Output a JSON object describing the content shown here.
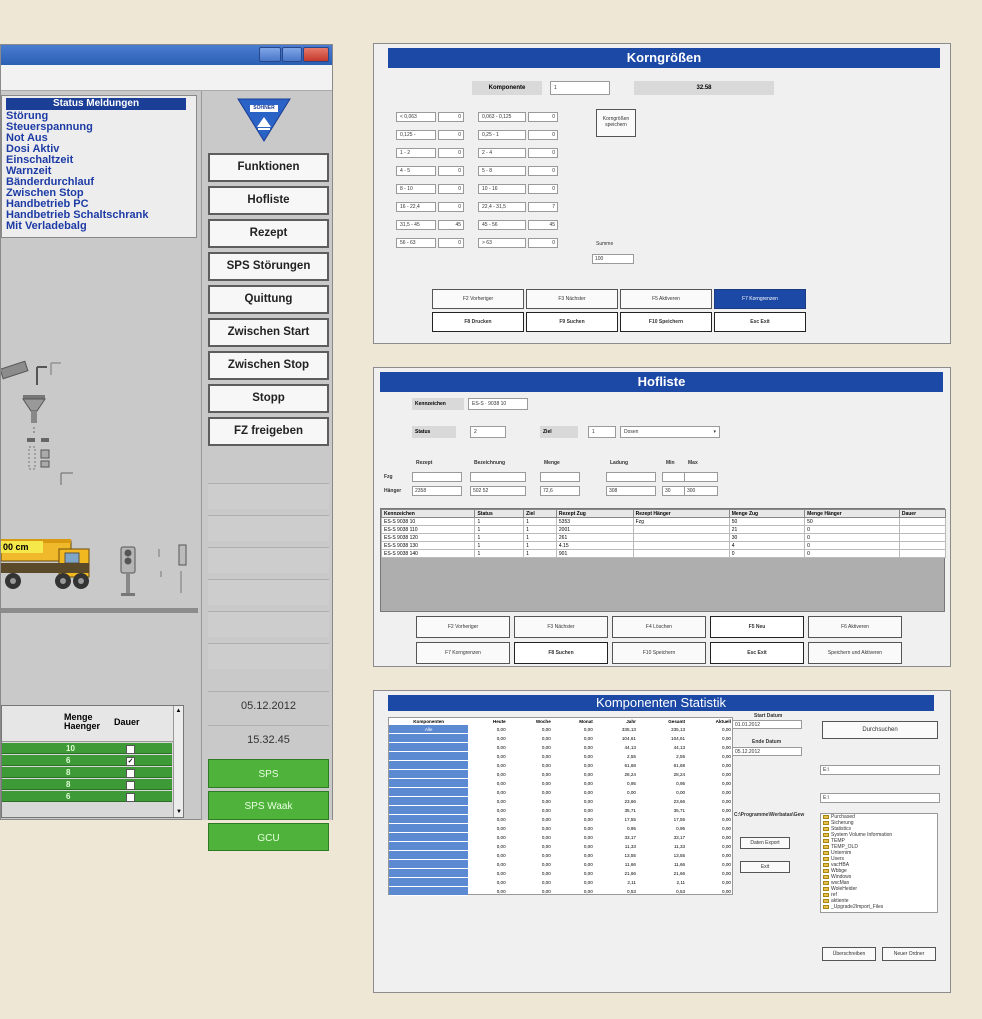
{
  "main_window": {
    "status_panel": {
      "title": "Status Meldungen",
      "items": [
        "Störung",
        "Steuerspannung",
        "Not Aus",
        "Dosi Aktiv",
        "Einschaltzeit",
        "Warnzeit",
        "Bänderdurchlauf",
        "Zwischen Stop",
        "Handbetrieb PC",
        "Handbetrieb Schaltschrank",
        "Mit Verladebalg"
      ]
    },
    "logo_text": "SÖHNER",
    "side_buttons": [
      "Funktionen",
      "Hofliste",
      "Rezept",
      "SPS Störungen",
      "Quittung",
      "Zwischen Start",
      "Zwischen Stop",
      "Stopp",
      "FZ freigeben"
    ],
    "date": "05.12.2012",
    "time": "15.32.45",
    "green_buttons": [
      "SPS",
      "SPS Waak",
      "GCU"
    ],
    "truck_label": "00 cm",
    "grid": {
      "headers": [
        "Menge Haenger",
        "Dauer"
      ],
      "rows": [
        {
          "menge": "10",
          "checked": false
        },
        {
          "menge": "6",
          "checked": true
        },
        {
          "menge": "8",
          "checked": false
        },
        {
          "menge": "8",
          "checked": false
        },
        {
          "menge": "6",
          "checked": false
        }
      ]
    },
    "colors": {
      "status_blue": "#1b3e96",
      "green": "#4fb23b"
    }
  },
  "korngroessen": {
    "title": "Korngrößen",
    "komponente_label": "Komponente",
    "komponente_value": "1",
    "komponente_total": "32.58",
    "left_labels": [
      "< 0,063",
      "0,125 -",
      "1 - 2",
      "4 - 5",
      "8 - 10",
      "16 - 22,4",
      "31,5 - 45",
      "56 - 63"
    ],
    "left_values": [
      "0",
      "0",
      "0",
      "0",
      "0",
      "0",
      "45",
      "0"
    ],
    "right_labels": [
      "0,063 - 0,125",
      "0,25 - 1",
      "2 - 4",
      "5 - 8",
      "10 - 16",
      "22,4 - 31,5",
      "45 - 56",
      "> 63"
    ],
    "right_values": [
      "0",
      "0",
      "0",
      "0",
      "0",
      "7",
      "45",
      "0"
    ],
    "action_button": "Korngrößen speichern",
    "summe_label": "Summe",
    "summe_value": "100",
    "buttons_row1": [
      "F2 Vorheriger",
      "F3 Nächster",
      "F5 Aktiveren",
      "F7 Korngrenzen"
    ],
    "buttons_row2": [
      "F8 Drucken",
      "F9 Suchen",
      "F10 Speichern",
      "Esc Exit"
    ]
  },
  "hofliste": {
    "title": "Hofliste",
    "kennzeichen_label": "Kennzeichen",
    "kennzeichen_value": "ES-S · 9038 10",
    "status_label": "Status",
    "status_value": "2",
    "ziel_label": "Ziel",
    "ziel_value": "1",
    "ziel_select": "Dosen",
    "col_labels": [
      "Rezept",
      "Bezeichnung",
      "Menge",
      "Ladung",
      "Min",
      "Max"
    ],
    "fzg_label": "Fzg",
    "haenger_label": "Hänger",
    "haenger_values": [
      "2358",
      "502 52",
      "72,6",
      "308",
      "30",
      "300"
    ],
    "table_headers": [
      "Kennzeichen",
      "Status",
      "Ziel",
      "Rezept Zug",
      "Rezept Hänger",
      "Menge Zug",
      "Menge Hänger",
      "Dauer"
    ],
    "table_rows": [
      [
        "ES-S 9038 10",
        "1",
        "1",
        "5353",
        "Fzg",
        "50",
        "50",
        ""
      ],
      [
        "ES-S 9038 110",
        "1",
        "1",
        "2001",
        "",
        "21",
        "0",
        ""
      ],
      [
        "ES-S 9038 120",
        "1",
        "1",
        "261",
        "",
        "30",
        "0",
        ""
      ],
      [
        "ES-S 9038 130",
        "1",
        "1",
        "4.15",
        "",
        "4",
        "0",
        ""
      ],
      [
        "ES-S 9038 140",
        "1",
        "1",
        "901",
        "",
        "0",
        "0",
        ""
      ]
    ],
    "buttons_row1": [
      "F2 Vorheriger",
      "F3 Nächster",
      "F4 Löschen",
      "F5 Neu",
      "F6 Aktiveren"
    ],
    "buttons_row2": [
      "F7 Korngrenzen",
      "F8 Suchen",
      "F10 Speichern",
      "Esc Exit",
      "Speichern und Aktiveren"
    ]
  },
  "komponenten": {
    "title": "Komponenten Statistik",
    "headers": [
      "Komponenten",
      "Heute",
      "Woche",
      "Monat",
      "Jahr",
      "Gesamt",
      "Aktuell"
    ],
    "rows": [
      [
        "Alle",
        "0,00",
        "0,00",
        "0,00",
        "335,13",
        "335,13",
        "0,00"
      ],
      [
        "",
        "0,00",
        "0,00",
        "0,00",
        "104,61",
        "104,61",
        "0,00"
      ],
      [
        "",
        "0,00",
        "0,00",
        "0,00",
        "44,13",
        "44,13",
        "0,00"
      ],
      [
        "",
        "0,00",
        "0,00",
        "0,00",
        "2,55",
        "2,55",
        "0,00"
      ],
      [
        "",
        "0,00",
        "0,00",
        "0,00",
        "61,68",
        "61,68",
        "0,00"
      ],
      [
        "",
        "0,00",
        "0,00",
        "0,00",
        "28,24",
        "28,24",
        "0,00"
      ],
      [
        "",
        "0,00",
        "0,00",
        "0,00",
        "0,95",
        "0,95",
        "0,00"
      ],
      [
        "",
        "0,00",
        "0,00",
        "0,00",
        "0,00",
        "0,00",
        "0,00"
      ],
      [
        "",
        "0,00",
        "0,00",
        "0,00",
        "23,66",
        "23,66",
        "0,00"
      ],
      [
        "",
        "0,00",
        "0,00",
        "0,00",
        "35,71",
        "35,71",
        "0,00"
      ],
      [
        "",
        "0,00",
        "0,00",
        "0,00",
        "17,55",
        "17,55",
        "0,00"
      ],
      [
        "",
        "0,00",
        "0,00",
        "0,00",
        "0,95",
        "0,95",
        "0,00"
      ],
      [
        "",
        "0,00",
        "0,00",
        "0,00",
        "33,17",
        "33,17",
        "0,00"
      ],
      [
        "",
        "0,00",
        "0,00",
        "0,00",
        "11,33",
        "11,33",
        "0,00"
      ],
      [
        "",
        "0,00",
        "0,00",
        "0,00",
        "13,55",
        "13,55",
        "0,00"
      ],
      [
        "",
        "0,00",
        "0,00",
        "0,00",
        "11,66",
        "11,66",
        "0,00"
      ],
      [
        "",
        "0,00",
        "0,00",
        "0,00",
        "21,66",
        "21,66",
        "0,00"
      ],
      [
        "",
        "0,00",
        "0,00",
        "0,00",
        "2,11",
        "2,11",
        "0,00"
      ],
      [
        "",
        "0,00",
        "0,00",
        "0,00",
        "0,53",
        "0,53",
        "0,00"
      ]
    ],
    "start_label": "Start Datum",
    "start_value": "01.01.2012",
    "ende_label": "Ende Datum",
    "ende_value": "05.12.2012",
    "durchsuchen": "Durchsuchen",
    "select1": "E:\\",
    "select2": "E:\\",
    "path_label": "C:\\Programme\\Werbatas\\Gew",
    "daten_export": "Daten Export",
    "exit": "Exit",
    "folders": [
      "Purchased",
      "Sicherung",
      "Statistics",
      "System Volume Information",
      "TEMP",
      "TEMP_OLD",
      "Unternim",
      "Users",
      "vacHBA",
      "Wbbge",
      "Windows",
      "wscMan",
      "WoleHeider",
      "ref",
      "aktiente",
      "_Upgrade2Import_Files"
    ],
    "ueberschreiben": "Überschreiben",
    "neuer_ordner": "Neuer Ordner"
  }
}
